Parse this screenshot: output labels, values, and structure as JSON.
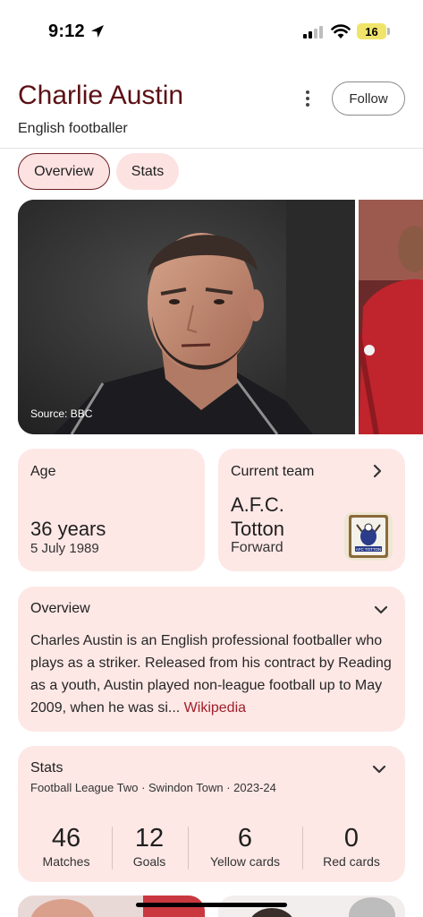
{
  "status_bar": {
    "time": "9:12",
    "battery_level": "16"
  },
  "header": {
    "title": "Charlie Austin",
    "subtitle": "English footballer",
    "follow_label": "Follow"
  },
  "tabs": [
    {
      "label": "Overview",
      "active": true
    },
    {
      "label": "Stats",
      "active": false
    }
  ],
  "media": {
    "source_label": "Source: BBC"
  },
  "age_card": {
    "label": "Age",
    "value": "36 years",
    "date": "5 July 1989"
  },
  "team_card": {
    "label": "Current team",
    "name": "A.F.C. Totton",
    "position": "Forward",
    "badge_text": "AFC TOTTON"
  },
  "overview": {
    "title": "Overview",
    "text": "Charles Austin is an English professional footballer who plays as a striker. Released from his contract by Reading as a youth, Austin played non-league football up to May 2009, when he was si...",
    "link_label": "Wikipedia"
  },
  "stats": {
    "title": "Stats",
    "subtitle": "Football League Two · Swindon Town · 2023-24",
    "items": [
      {
        "value": "46",
        "label": "Matches"
      },
      {
        "value": "12",
        "label": "Goals"
      },
      {
        "value": "6",
        "label": "Yellow cards"
      },
      {
        "value": "0",
        "label": "Red cards"
      }
    ]
  },
  "colors": {
    "accent": "#5c1014",
    "card_bg": "#fde8e6",
    "link": "#a0202a"
  }
}
